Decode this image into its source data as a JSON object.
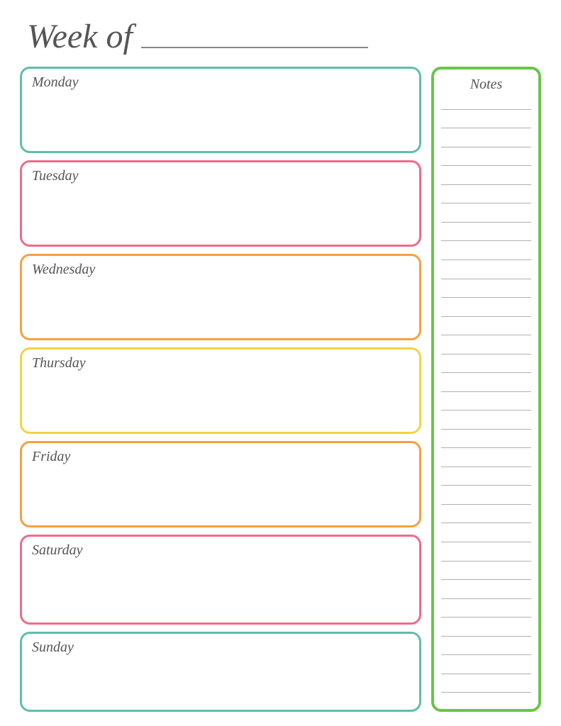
{
  "header": {
    "week_of_label": "Week of",
    "underline_placeholder": ""
  },
  "days": [
    {
      "id": "monday",
      "label": "Monday",
      "color_class": "monday"
    },
    {
      "id": "tuesday",
      "label": "Tuesday",
      "color_class": "tuesday"
    },
    {
      "id": "wednesday",
      "label": "Wednesday",
      "color_class": "wednesday"
    },
    {
      "id": "thursday",
      "label": "Thursday",
      "color_class": "thursday"
    },
    {
      "id": "friday",
      "label": "Friday",
      "color_class": "friday"
    },
    {
      "id": "saturday",
      "label": "Saturday",
      "color_class": "saturday"
    },
    {
      "id": "sunday",
      "label": "Sunday",
      "color_class": "sunday"
    }
  ],
  "notes": {
    "title": "Notes",
    "line_count": 32
  }
}
